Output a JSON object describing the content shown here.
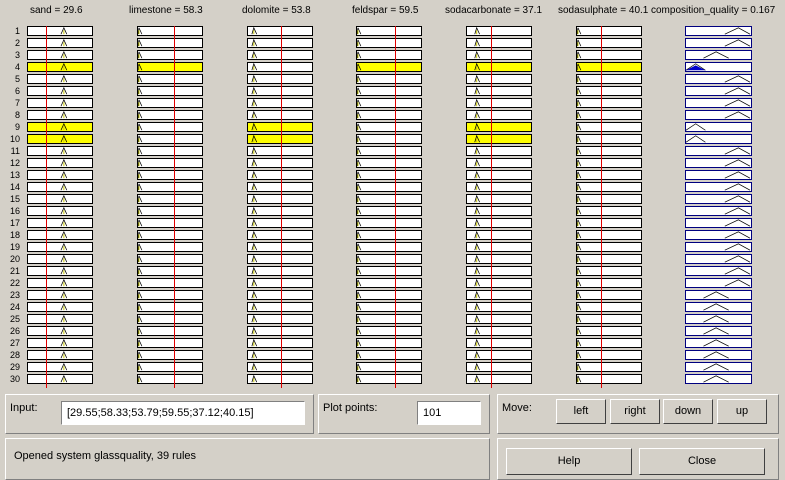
{
  "headers": [
    {
      "key": "sand",
      "text": "sand = 29.6"
    },
    {
      "key": "limestone",
      "text": "limestone = 58.3"
    },
    {
      "key": "dolomite",
      "text": "dolomite = 53.8"
    },
    {
      "key": "feldspar",
      "text": "feldspar = 59.5"
    },
    {
      "key": "sodacarbonate",
      "text": "sodacarbonate = 37.1"
    },
    {
      "key": "sodasulphate",
      "text": "sodasulphate = 40.1"
    },
    {
      "key": "composition_quality",
      "text": "composition_quality = 0.167"
    }
  ],
  "row_numbers": [
    "1",
    "2",
    "3",
    "4",
    "5",
    "6",
    "7",
    "8",
    "9",
    "10",
    "11",
    "12",
    "13",
    "14",
    "15",
    "16",
    "17",
    "18",
    "19",
    "20",
    "21",
    "22",
    "23",
    "24",
    "25",
    "26",
    "27",
    "28",
    "29",
    "30"
  ],
  "input_values": {
    "sand": 29.55,
    "limestone": 58.33,
    "dolomite": 53.79,
    "feldspar": 59.55,
    "sodacarbonate": 37.12,
    "sodasulphate": 40.15
  },
  "output_value": 0.167,
  "fired_rules": [
    4,
    9,
    10
  ],
  "input_panel": {
    "label": "Input:",
    "value": "[29.55;58.33;53.79;59.55;37.12;40.15]"
  },
  "plot_points": {
    "label": "Plot points:",
    "value": "101"
  },
  "move": {
    "label": "Move:",
    "left": "left",
    "right": "right",
    "down": "down",
    "up": "up"
  },
  "status_text": "Opened system glassquality, 39 rules",
  "help_label": "Help",
  "close_label": "Close"
}
